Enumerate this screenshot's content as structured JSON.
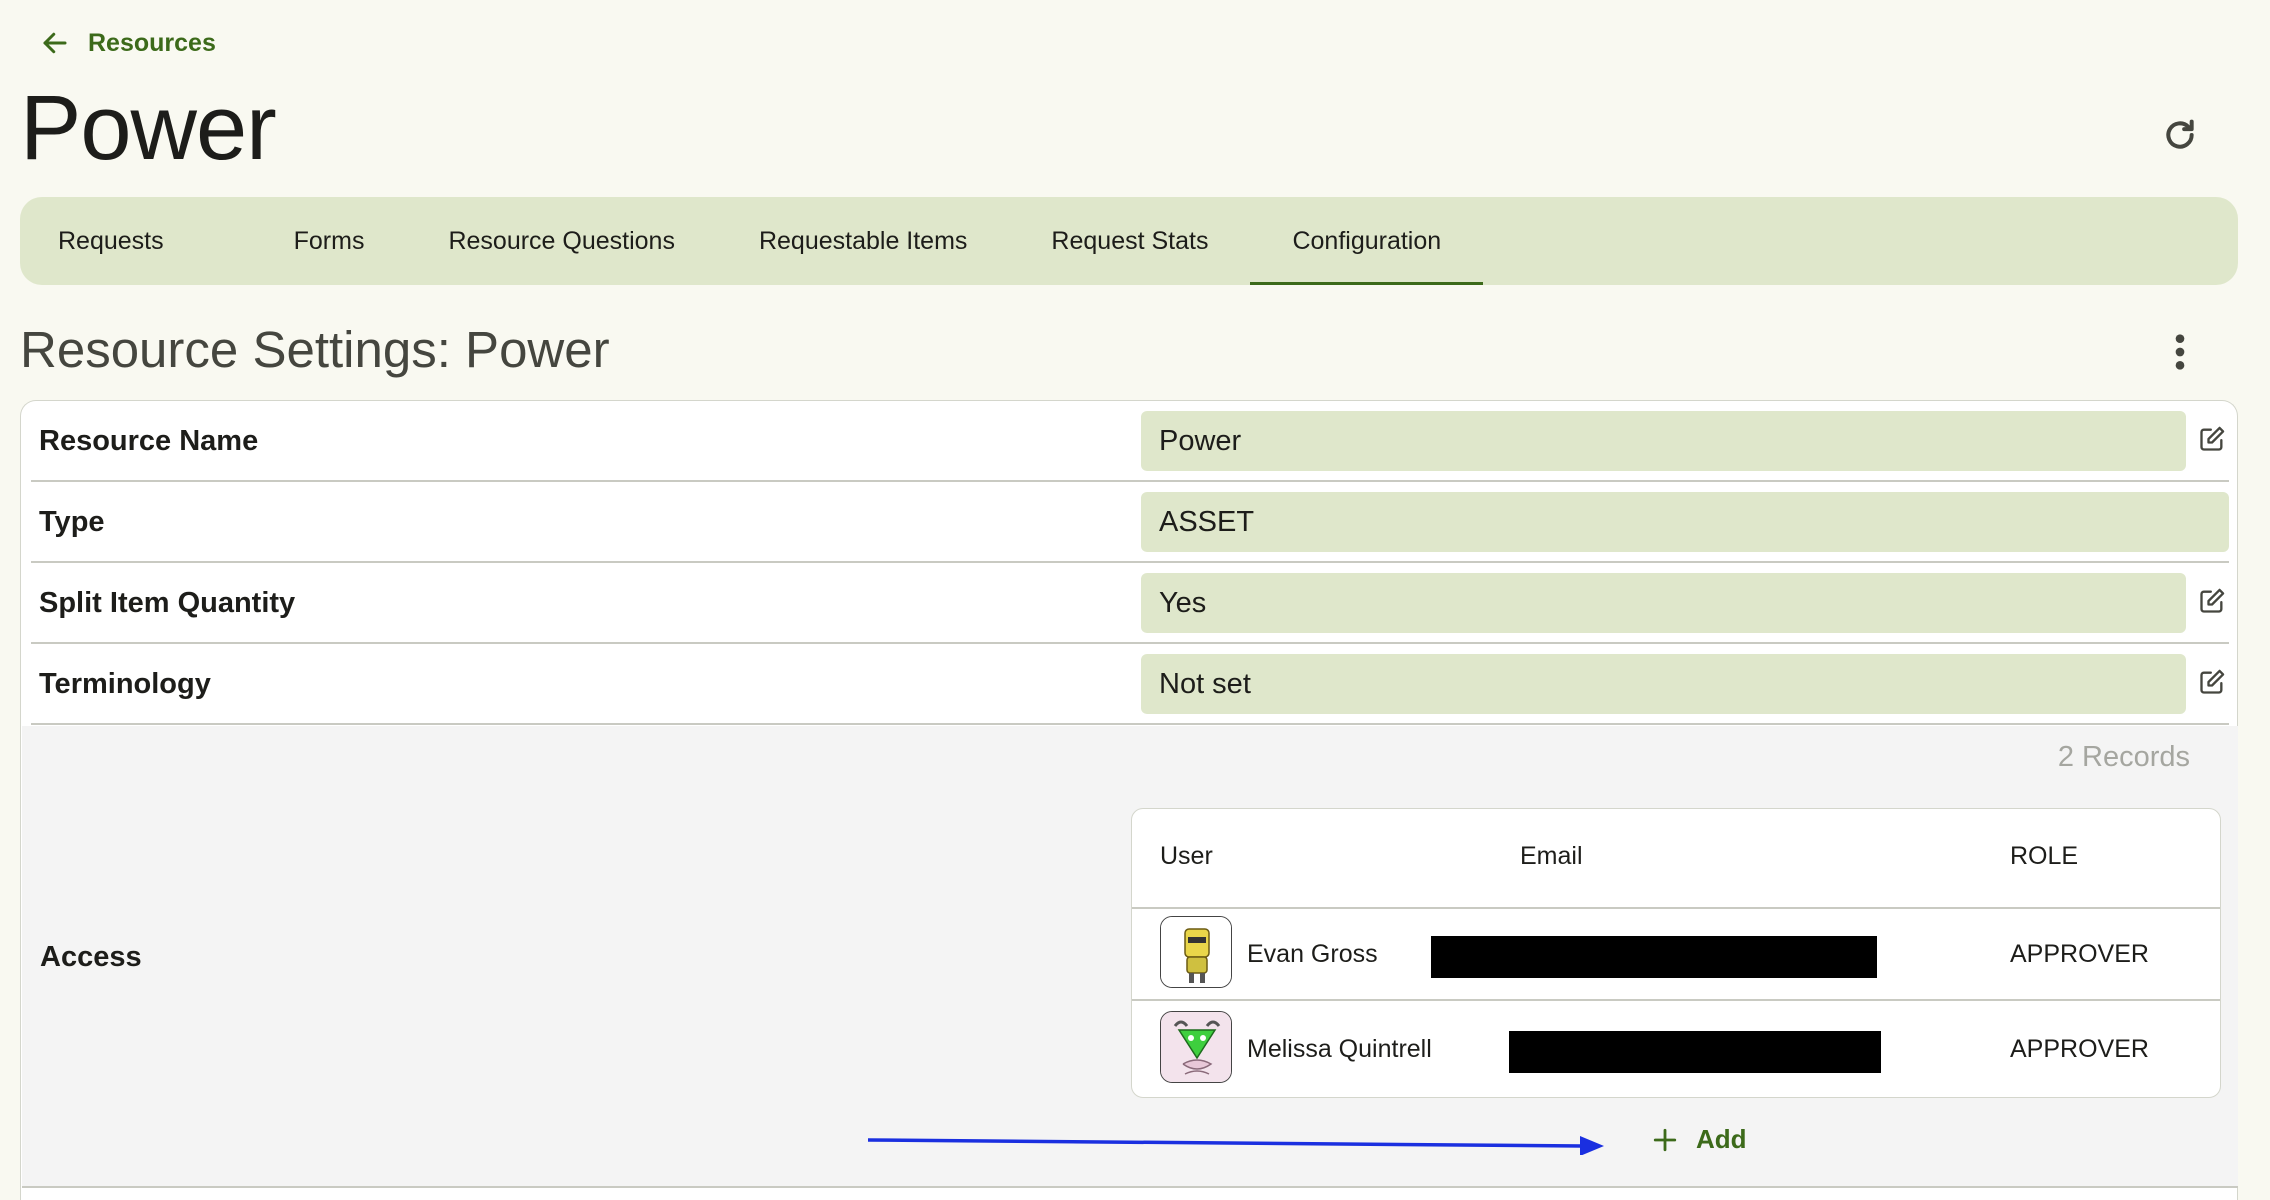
{
  "nav": {
    "back_label": "Resources"
  },
  "page": {
    "title": "Power"
  },
  "tabs": [
    {
      "label": "Requests",
      "active": false
    },
    {
      "label": "Forms",
      "active": false
    },
    {
      "label": "Resource Questions",
      "active": false
    },
    {
      "label": "Requestable Items",
      "active": false
    },
    {
      "label": "Request Stats",
      "active": false
    },
    {
      "label": "Configuration",
      "active": true
    }
  ],
  "section": {
    "title": "Resource Settings: Power"
  },
  "settings": [
    {
      "label": "Resource Name",
      "value": "Power",
      "editable": true
    },
    {
      "label": "Type",
      "value": "ASSET",
      "editable": false
    },
    {
      "label": "Split Item Quantity",
      "value": "Yes",
      "editable": true
    },
    {
      "label": "Terminology",
      "value": "Not set",
      "editable": true
    }
  ],
  "access": {
    "label": "Access",
    "records_count": "2 Records",
    "columns": {
      "user": "User",
      "email": "Email",
      "role": "ROLE"
    },
    "rows": [
      {
        "user": "Evan Gross",
        "role": "APPROVER"
      },
      {
        "user": "Melissa Quintrell",
        "role": "APPROVER"
      }
    ],
    "add_label": "Add"
  },
  "colors": {
    "accent": "#3c6a1a",
    "tab_bar": "#dfe7cb",
    "background": "#f9f9f1",
    "annotation_arrow": "#1a2fe0"
  },
  "icons": {
    "back": "arrow-left-icon",
    "refresh": "refresh-icon",
    "more": "more-vertical-icon",
    "edit": "edit-icon",
    "add": "plus-icon"
  }
}
